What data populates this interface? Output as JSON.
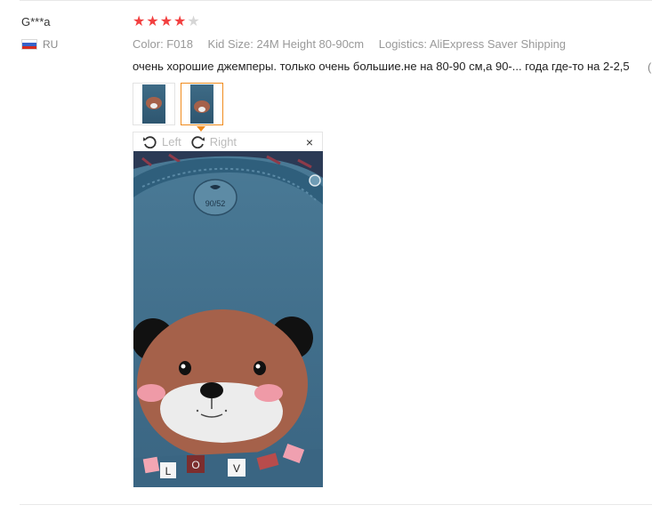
{
  "review": {
    "user": "G***a",
    "country": "RU",
    "rating": 4,
    "max_rating": 5,
    "color": "Color: F018",
    "kid_size": "Kid Size: 24M Height 80-90cm",
    "logistics": "Logistics: AliExpress Saver Shipping",
    "text": "очень хорошие джемперы. только очень большие.не на 80-90 см,а 90-... года где-то на 2-2,5",
    "more": "("
  },
  "viewer": {
    "left_label": "Left",
    "right_label": "Right",
    "close": "×",
    "print_text": "90/52",
    "letters": [
      "L",
      "O",
      "V"
    ]
  },
  "colors": {
    "star": "#f24040",
    "active_thumb": "#f08b1d",
    "sweater": "#3f6b86"
  }
}
